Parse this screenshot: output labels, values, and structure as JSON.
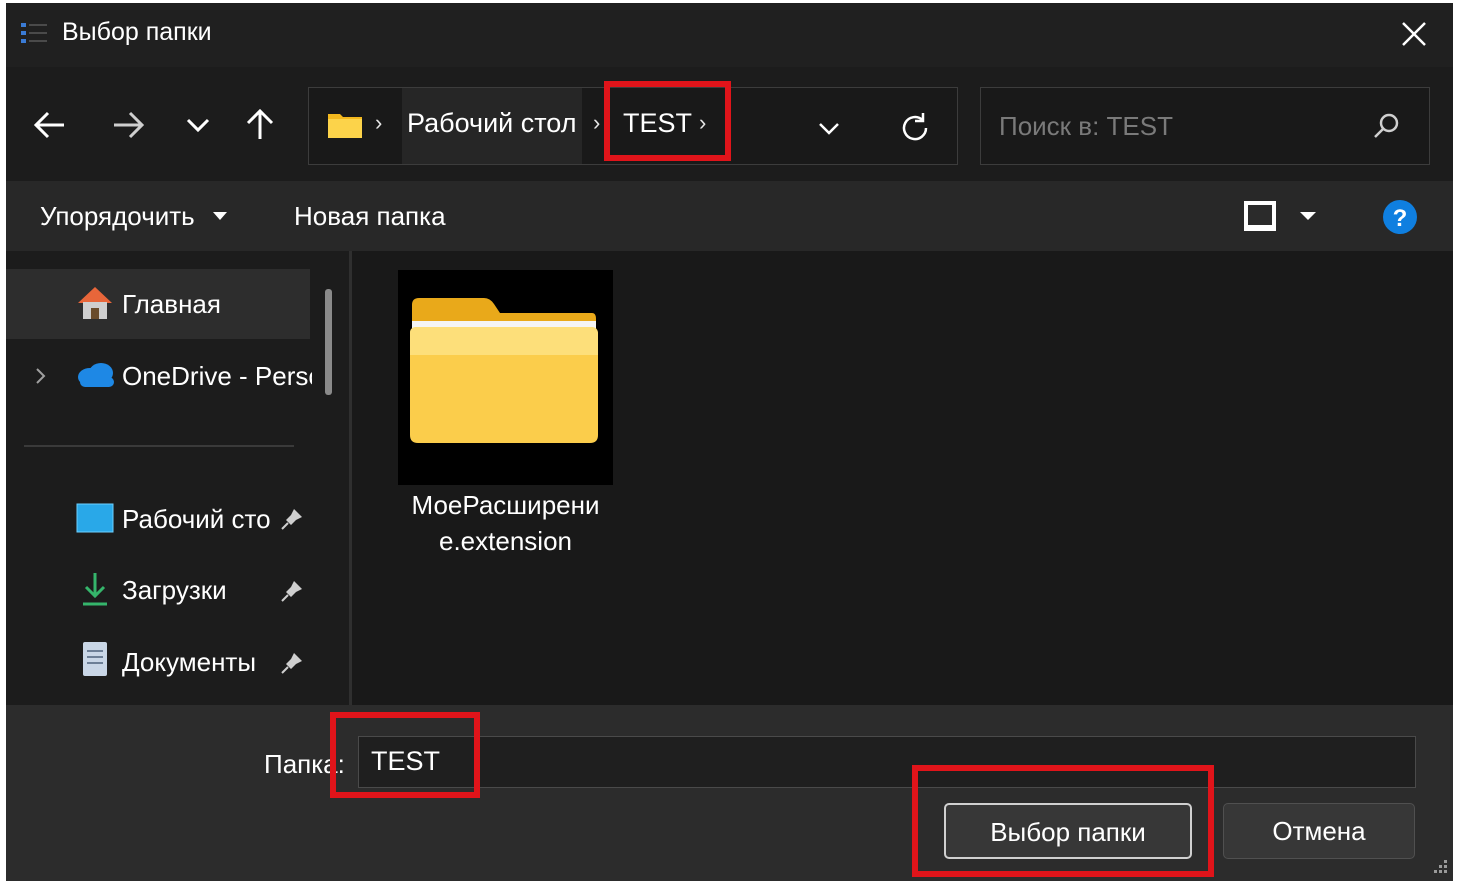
{
  "window": {
    "title": "Выбор папки",
    "icons": {
      "app": "folder-picker-list-icon",
      "close": "close-icon"
    }
  },
  "navigation": {
    "back_icon": "arrow-left-icon",
    "forward_icon": "arrow-right-icon",
    "recent_icon": "chevron-down-icon",
    "up_icon": "arrow-up-icon"
  },
  "address": {
    "root_icon": "folder-icon",
    "breadcrumbs": [
      {
        "label": "Рабочий стол"
      },
      {
        "label": "TEST"
      }
    ],
    "separator": "›",
    "dropdown_icon": "chevron-down-icon",
    "refresh_icon": "refresh-icon"
  },
  "search": {
    "placeholder": "Поиск в: TEST",
    "icon": "search-icon"
  },
  "commands": {
    "organize": "Упорядочить",
    "new_folder": "Новая папка",
    "view_icon": "view-pane-icon",
    "help_icon": "help-icon"
  },
  "sidebar": {
    "items": [
      {
        "label": "Главная",
        "icon": "home-icon",
        "selected": true
      },
      {
        "label": "OneDrive - Persc",
        "icon": "onedrive-cloud-icon",
        "expandable": true
      }
    ],
    "quick_access": [
      {
        "label": "Рабочий сто",
        "icon": "desktop-icon",
        "pinned": true
      },
      {
        "label": "Загрузки",
        "icon": "download-icon",
        "pinned": true
      },
      {
        "label": "Документы",
        "icon": "document-icon",
        "pinned": true
      }
    ]
  },
  "content": {
    "items": [
      {
        "name_line1": "МоеРасширени",
        "name_line2": "e.extension",
        "icon": "folder-large-icon"
      }
    ]
  },
  "footer": {
    "folder_label": "Папка:",
    "folder_value": "TEST",
    "select_button": "Выбор папки",
    "cancel_button": "Отмена"
  },
  "colors": {
    "background": "#202020",
    "annotation": "#e0141a",
    "folder_yellow": "#f6c342",
    "help_blue": "#0f7fe0"
  }
}
